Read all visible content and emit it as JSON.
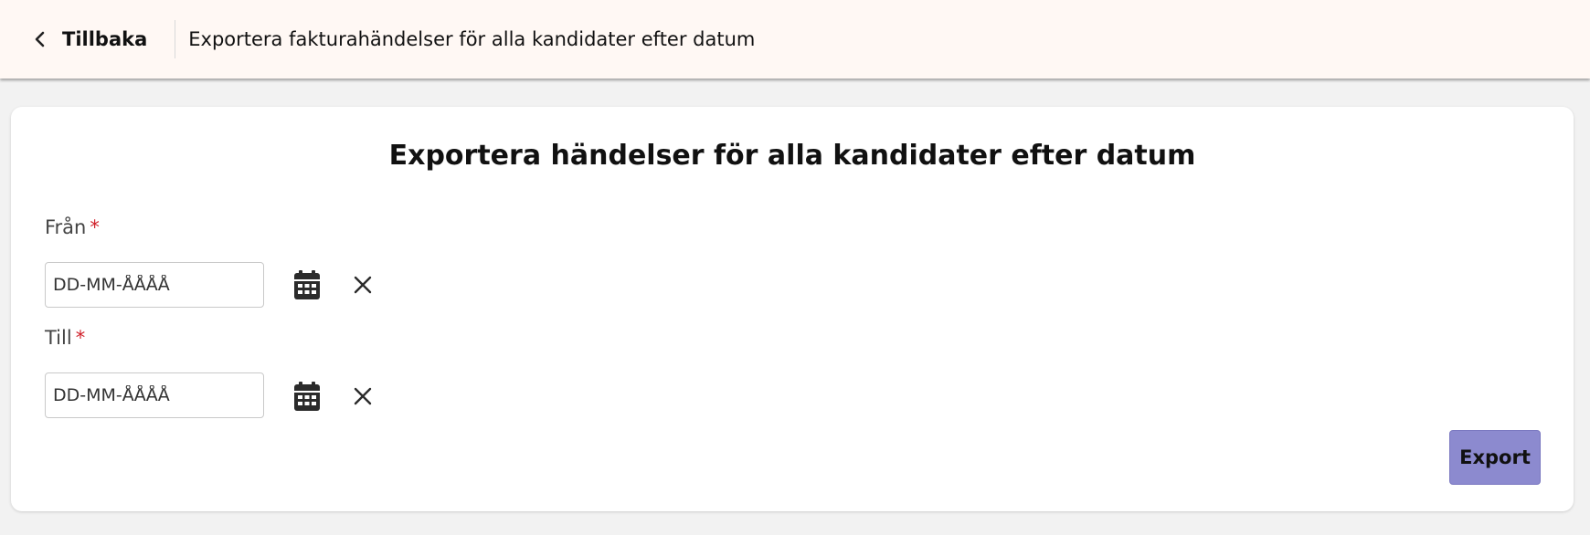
{
  "header": {
    "back_label": "Tillbaka",
    "title": "Exportera fakturahändelser för alla kandidater efter datum"
  },
  "card": {
    "title": "Exportera händelser för alla kandidater efter datum",
    "from": {
      "label": "Från",
      "required_mark": "*",
      "placeholder": "DD-MM-ÅÅÅÅ",
      "value": ""
    },
    "to": {
      "label": "Till",
      "required_mark": "*",
      "placeholder": "DD-MM-ÅÅÅÅ",
      "value": ""
    },
    "export_label": "Export"
  },
  "icons": {
    "back": "chevron-left-icon",
    "calendar": "calendar-icon",
    "clear": "close-icon"
  },
  "colors": {
    "header_bg": "#fff8f4",
    "page_bg": "#f2f2f2",
    "required": "#d0202a",
    "export_button": "#8c8acf"
  }
}
